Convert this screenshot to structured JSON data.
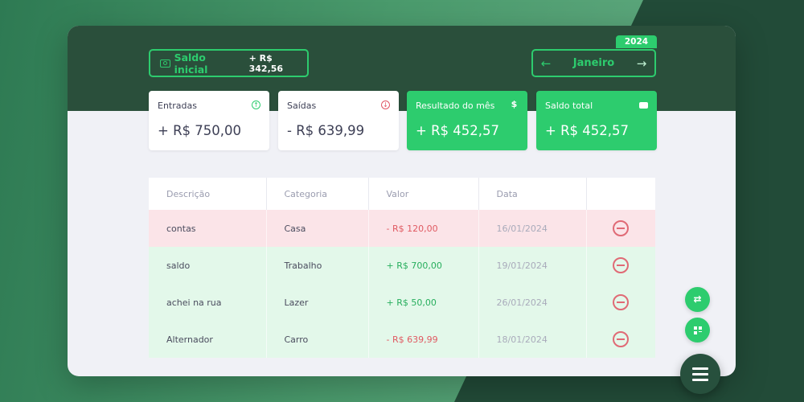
{
  "header": {
    "saldo_inicial": {
      "label": "Saldo inicial",
      "value": "+ R$ 342,56",
      "icon": "cash-icon"
    },
    "month_nav": {
      "month": "Janeiro",
      "year": "2024",
      "prev_icon": "arrow-left-icon",
      "next_icon": "arrow-right-icon"
    }
  },
  "stats": [
    {
      "title": "Entradas",
      "value": "+ R$ 750,00",
      "icon": "arrow-up-circle-icon"
    },
    {
      "title": "Saídas",
      "value": "- R$ 639,99",
      "icon": "arrow-down-circle-icon"
    },
    {
      "title": "Resultado do mês",
      "value": "+ R$ 452,57",
      "icon": "dollar-icon"
    },
    {
      "title": "Saldo total",
      "value": "+ R$ 452,57",
      "icon": "wallet-icon"
    }
  ],
  "table": {
    "columns": [
      "Descrição",
      "Categoria",
      "Valor",
      "Data"
    ],
    "rows": [
      {
        "description": "contas",
        "category": "Casa",
        "amount": "- R$ 120,00",
        "date": "16/01/2024",
        "type": "saida"
      },
      {
        "description": "saldo",
        "category": "Trabalho",
        "amount": "+ R$ 700,00",
        "date": "19/01/2024",
        "type": "entrada"
      },
      {
        "description": "achei na rua",
        "category": "Lazer",
        "amount": "+ R$ 50,00",
        "date": "26/01/2024",
        "type": "entrada"
      },
      {
        "description": "Alternador",
        "category": "Carro",
        "amount": "- R$ 639,99",
        "date": "18/01/2024",
        "type": "saida"
      }
    ]
  },
  "colors": {
    "accent": "#2dcc6e",
    "header_bg": "#2a4f3b",
    "negative": "#e05a62",
    "positive": "#27ae5d"
  },
  "actions": {
    "transfer_icon": "swap-arrows-icon",
    "add_category_icon": "grid-add-icon",
    "menu_icon": "hamburger-menu-icon"
  }
}
